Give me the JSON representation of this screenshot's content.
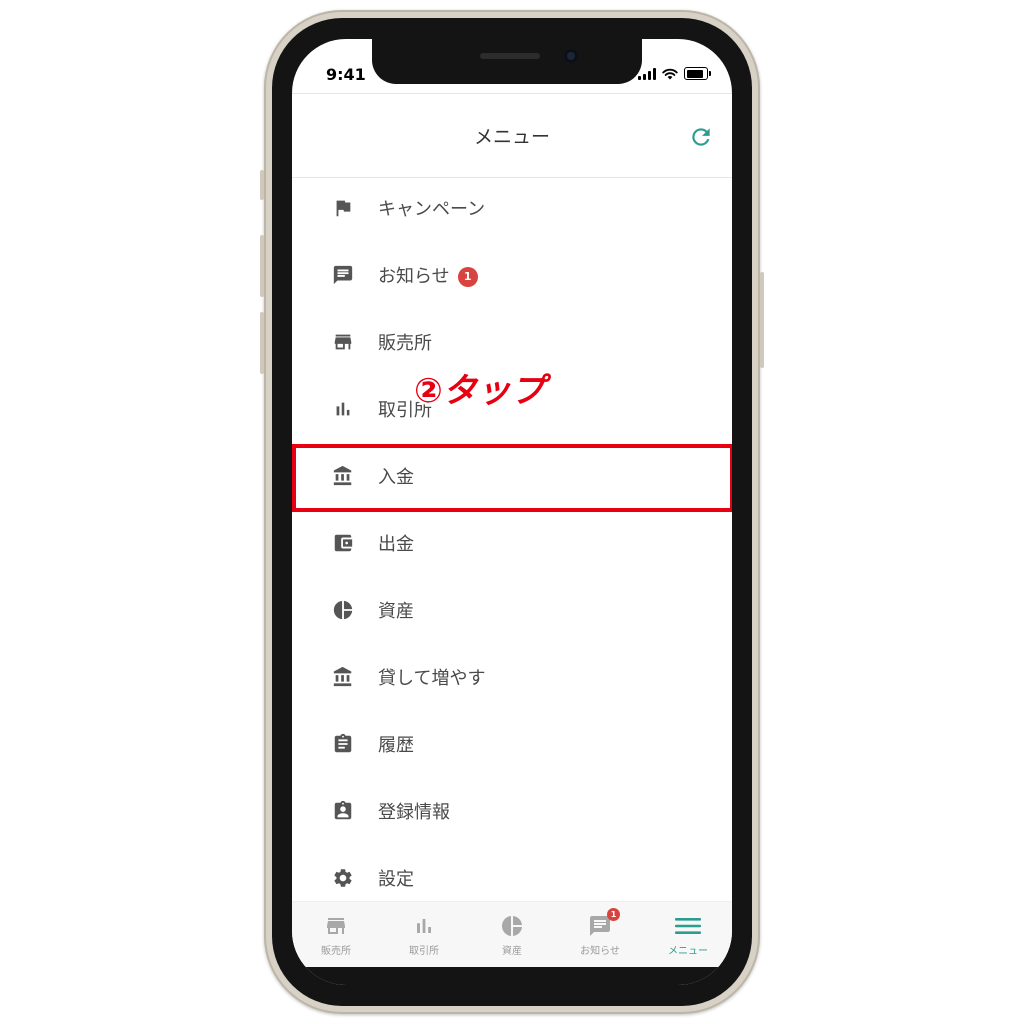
{
  "status_bar": {
    "time": "9:41"
  },
  "header": {
    "title": "メニュー"
  },
  "menu": {
    "items": [
      {
        "label": "キャンペーン",
        "icon": "flag-icon"
      },
      {
        "label": "お知らせ",
        "icon": "message-icon",
        "badge": "1"
      },
      {
        "label": "販売所",
        "icon": "store-icon"
      },
      {
        "label": "取引所",
        "icon": "bar-chart-icon"
      },
      {
        "label": "入金",
        "icon": "bank-icon"
      },
      {
        "label": "出金",
        "icon": "wallet-icon"
      },
      {
        "label": "資産",
        "icon": "pie-chart-icon"
      },
      {
        "label": "貸して増やす",
        "icon": "bank-icon"
      },
      {
        "label": "履歴",
        "icon": "clipboard-icon"
      },
      {
        "label": "登録情報",
        "icon": "contact-icon"
      },
      {
        "label": "設定",
        "icon": "gear-icon"
      }
    ]
  },
  "annotation": {
    "text": "②タップ",
    "color": "#e60012"
  },
  "tabbar": {
    "items": [
      {
        "label": "販売所",
        "icon": "store-icon"
      },
      {
        "label": "取引所",
        "icon": "bar-chart-icon"
      },
      {
        "label": "資産",
        "icon": "pie-chart-icon"
      },
      {
        "label": "お知らせ",
        "icon": "message-icon",
        "badge": "1"
      },
      {
        "label": "メニュー",
        "icon": "hamburger-icon",
        "active": true
      }
    ]
  },
  "colors": {
    "accent": "#2a9d8f",
    "badge": "#d9433f",
    "highlight": "#e60012",
    "icon": "#555555"
  }
}
